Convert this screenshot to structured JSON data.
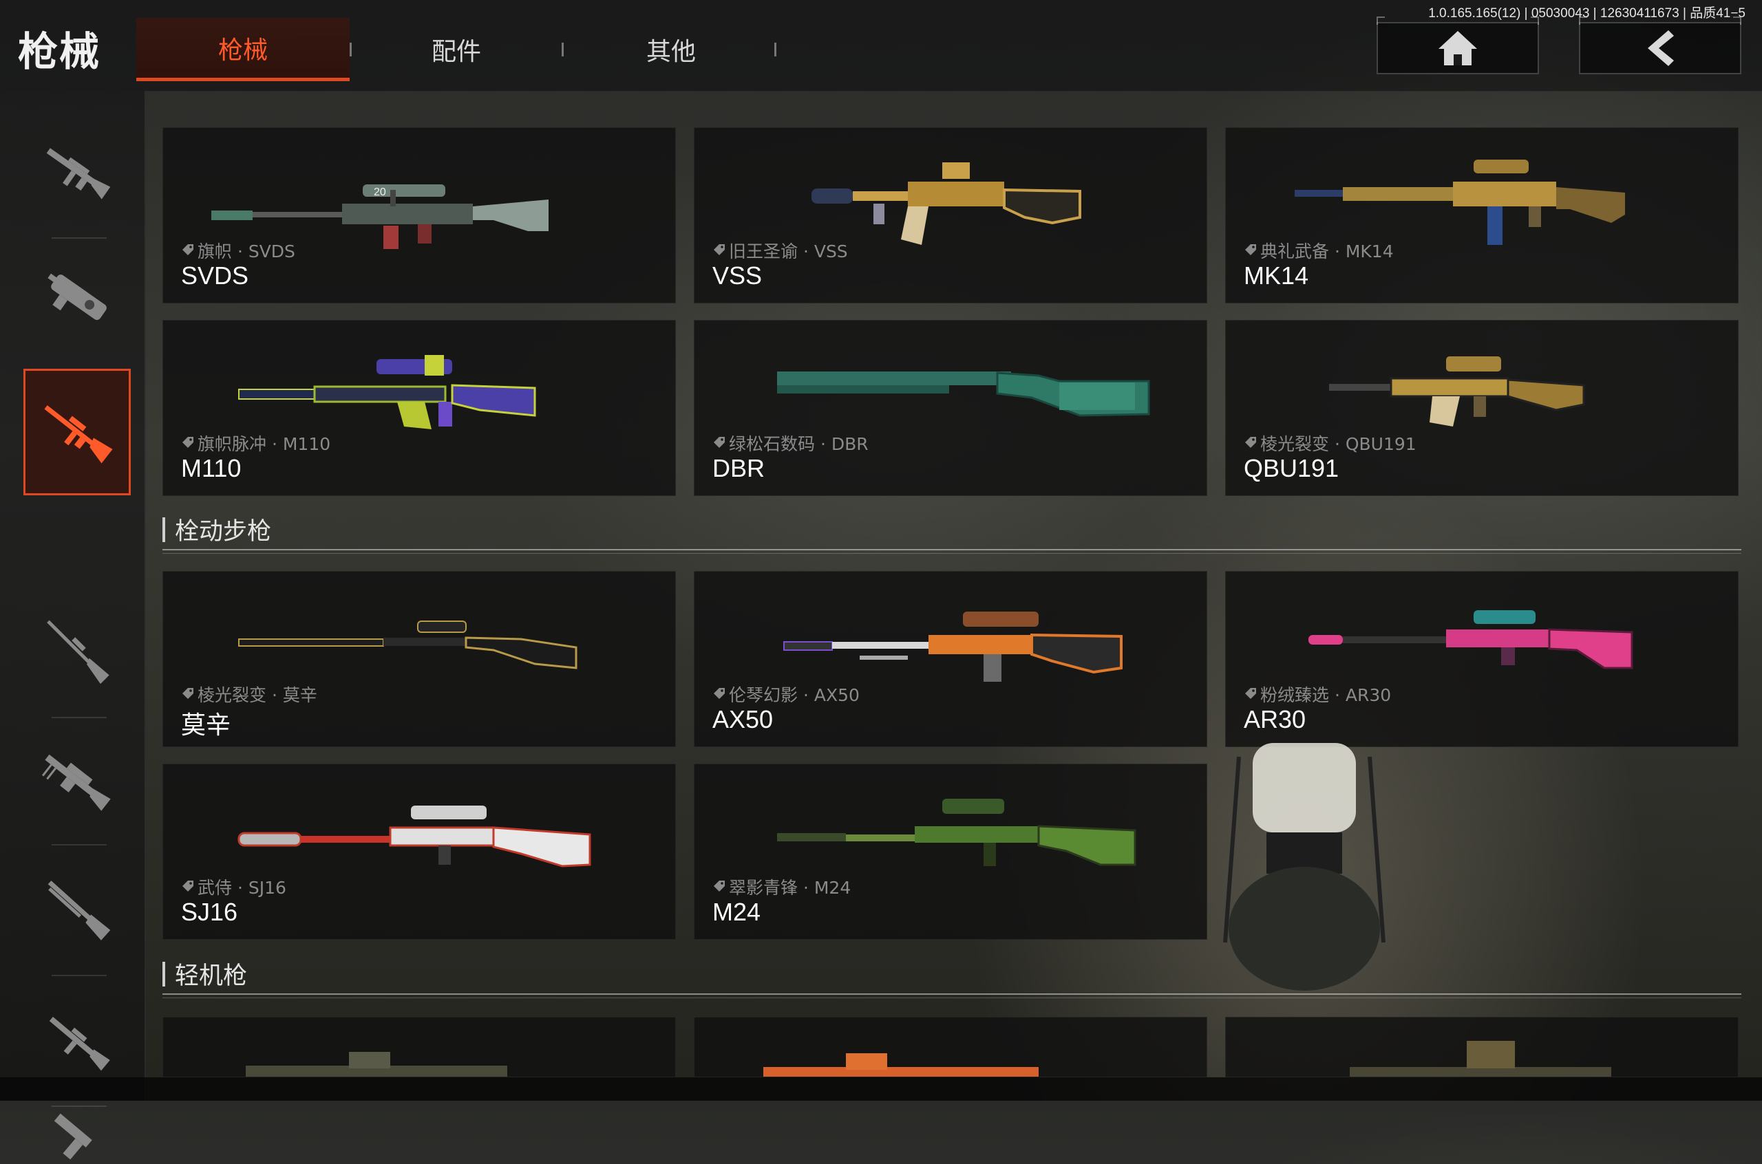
{
  "header": {
    "title": "枪械",
    "tabs": [
      {
        "label": "枪械",
        "active": true
      },
      {
        "label": "配件",
        "active": false
      },
      {
        "label": "其他",
        "active": false
      }
    ],
    "version": "1.0.165.165(12) | 05030043 | 12630411673 | 品质41−5",
    "home_button": "home-icon",
    "back_button": "back-arrow-icon"
  },
  "sidebar": {
    "categories": [
      {
        "icon": "assault-rifle-icon",
        "active": false
      },
      {
        "icon": "smg-icon",
        "active": false
      },
      {
        "icon": "marksman-rifle-icon",
        "active": true
      },
      {
        "icon": "sniper-rifle-icon",
        "active": false
      },
      {
        "icon": "light-machine-gun-icon",
        "active": false
      },
      {
        "icon": "shotgun-icon",
        "active": false
      },
      {
        "icon": "carbine-icon",
        "active": false
      },
      {
        "icon": "pistol-icon",
        "active": false
      }
    ]
  },
  "sections": [
    {
      "title": "",
      "cards": [
        {
          "skin": "旗帜 · SVDS",
          "name": "SVDS"
        },
        {
          "skin": "旧王圣谕 · VSS",
          "name": "VSS"
        },
        {
          "skin": "典礼武备 · MK14",
          "name": "MK14"
        },
        {
          "skin": "旗帜脉冲 · M110",
          "name": "M110"
        },
        {
          "skin": "绿松石数码 · DBR",
          "name": "DBR"
        },
        {
          "skin": "棱光裂变 · QBU191",
          "name": "QBU191"
        }
      ]
    },
    {
      "title": "栓动步枪",
      "cards": [
        {
          "skin": "棱光裂变 · 莫辛",
          "name": "莫辛"
        },
        {
          "skin": "伦琴幻影 · AX50",
          "name": "AX50"
        },
        {
          "skin": "粉绒臻选 · AR30",
          "name": "AR30"
        },
        {
          "skin": "武侍 · SJ16",
          "name": "SJ16"
        },
        {
          "skin": "翠影青锋 · M24",
          "name": "M24"
        }
      ]
    },
    {
      "title": "轻机枪",
      "cards": []
    }
  ],
  "colors": {
    "accent": "#e0481f",
    "accent_text": "#ff5a2a",
    "card_bg": "#121212",
    "skin_text": "#8b8b8b"
  }
}
